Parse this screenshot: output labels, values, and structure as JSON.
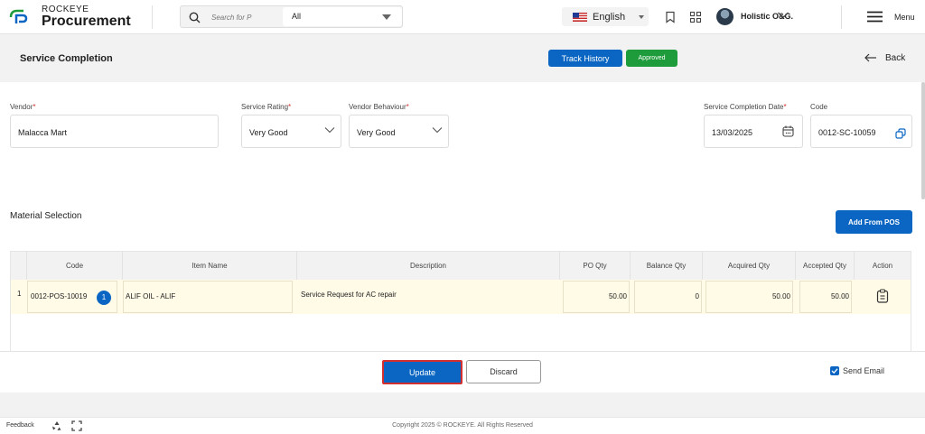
{
  "topbar": {
    "brand_small": "ROCKEYE",
    "brand_big": "Procurement",
    "search_placeholder": "Search for P",
    "search_scope": "All",
    "language": "English",
    "user_name": "Holistic O&G.",
    "menu_label": "Menu"
  },
  "header": {
    "title": "Service Completion",
    "track_history": "Track History",
    "status": "Approved",
    "back": "Back"
  },
  "form": {
    "vendor_label": "Vendor",
    "vendor_value": "Malacca Mart",
    "rating_label": "Service Rating",
    "rating_value": "Very Good",
    "behaviour_label": "Vendor Behaviour",
    "behaviour_value": "Very Good",
    "date_label": "Service Completion Date",
    "date_value": "13/03/2025",
    "code_label": "Code",
    "code_value": "0012-SC-10059",
    "required_mark": "*"
  },
  "materials": {
    "title": "Material Selection",
    "add_button": "Add From POS",
    "columns": [
      "Code",
      "Item Name",
      "Description",
      "PO Qty",
      "Balance Qty",
      "Acquired Qty",
      "Accepted Qty",
      "Action"
    ],
    "rows": [
      {
        "index": "1",
        "code": "0012-POS-10019",
        "code_count": "1",
        "item_name": "ALIF OIL - ALIF",
        "description": "Service Request for AC repair",
        "po_qty": "50.00",
        "balance_qty": "0",
        "acquired_qty": "50.00",
        "accepted_qty": "50.00"
      }
    ]
  },
  "actions": {
    "update": "Update",
    "discard": "Discard",
    "send_email": "Send Email"
  },
  "footer": {
    "feedback": "Feedback",
    "copyright": "Copyright 2025 © ROCKEYE. All Rights Reserved"
  },
  "colors": {
    "primary": "#0a66c2",
    "approved": "#1e9b3a",
    "row_highlight": "#fffbe6",
    "update_outline": "#d32f2f"
  }
}
